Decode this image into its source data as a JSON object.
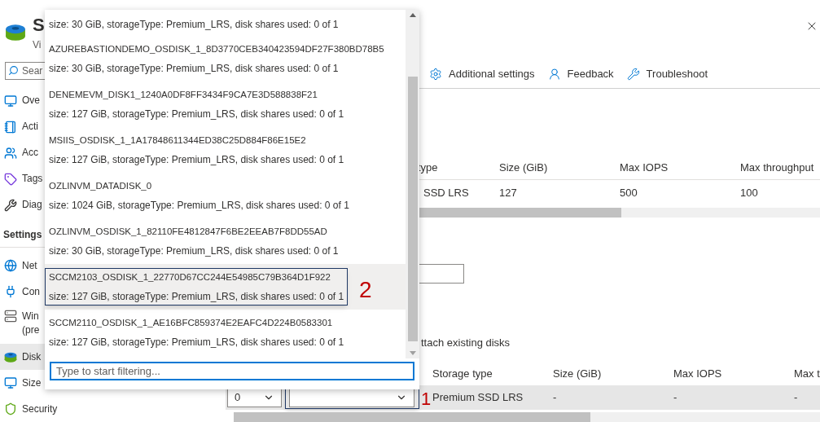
{
  "blade": {
    "title": "S",
    "subtitle": "Vi"
  },
  "sidebar": {
    "search_placeholder": "Sear",
    "items": [
      {
        "kind": "item",
        "label": "Ove",
        "selected": false
      },
      {
        "kind": "item",
        "label": "Acti",
        "selected": false
      },
      {
        "kind": "item",
        "label": "Acc",
        "selected": false
      },
      {
        "kind": "item",
        "label": "Tags",
        "selected": false
      },
      {
        "kind": "item",
        "label": "Diag",
        "selected": false
      },
      {
        "kind": "header",
        "label": "Settings"
      },
      {
        "kind": "item",
        "label": "Net",
        "selected": false
      },
      {
        "kind": "item",
        "label": "Con",
        "selected": false
      },
      {
        "kind": "item",
        "label": "Win",
        "sublabel": "(pre",
        "selected": false
      },
      {
        "kind": "item",
        "label": "Disk",
        "selected": true
      },
      {
        "kind": "item",
        "label": "Size",
        "selected": false
      },
      {
        "kind": "item",
        "label": "Security",
        "selected": false
      }
    ]
  },
  "toolbar": [
    "Additional settings",
    "Feedback",
    "Troubleshoot"
  ],
  "os_disk_table": {
    "columns": [
      "type",
      "Size (GiB)",
      "Max IOPS",
      "Max throughput"
    ],
    "rows": [
      [
        "SSD LRS",
        "127",
        "500",
        "100"
      ]
    ]
  },
  "attach_existing_label": "ttach existing disks",
  "data_disk_table": {
    "columns": [
      "Storage type",
      "Size (GiB)",
      "Max IOPS",
      "Max t"
    ],
    "rows": [
      {
        "lun": "0",
        "cells": [
          "Premium SSD LRS",
          "-",
          "-",
          "-"
        ]
      }
    ]
  },
  "dropdown": {
    "partial_item_detail": "size: 30 GiB, storageType: Premium_LRS, disk shares used: 0 of 1",
    "items": [
      {
        "name": "AZUREBASTIONDEMO_OSDISK_1_8D3770CEB340423594DF27F380BD78B5",
        "detail": "size: 30 GiB, storageType: Premium_LRS, disk shares used: 0 of 1",
        "selected": false
      },
      {
        "name": "DENEMEVM_DISK1_1240A0DF8FF3434F9CA7E3D588838F21",
        "detail": "size: 127 GiB, storageType: Premium_LRS, disk shares used: 0 of 1",
        "selected": false
      },
      {
        "name": "MSIIS_OSDISK_1_1A17848611344ED38C25D884F86E15E2",
        "detail": "size: 127 GiB, storageType: Premium_LRS, disk shares used: 0 of 1",
        "selected": false
      },
      {
        "name": "OZLINVM_DATADISK_0",
        "detail": "size: 1024 GiB, storageType: Premium_LRS, disk shares used: 0 of 1",
        "selected": false
      },
      {
        "name": "OZLINVM_OSDISK_1_82110FE4812847F6BE2EEAB7F8DD55AD",
        "detail": "size: 30 GiB, storageType: Premium_LRS, disk shares used: 0 of 1",
        "selected": false
      },
      {
        "name": "SCCM2103_OSDISK_1_22770D67CC244E54985C79B364D1F922",
        "detail": "size: 127 GiB, storageType: Premium_LRS, disk shares used: 0 of 1",
        "selected": true
      },
      {
        "name": "SCCM2110_OSDISK_1_AE16BFC859374E2EAFC4D224B0583301",
        "detail": "size: 127 GiB, storageType: Premium_LRS, disk shares used: 0 of 1",
        "selected": false
      }
    ],
    "filter_placeholder": "Type to start filtering..."
  },
  "annotations": [
    "2",
    "1"
  ]
}
